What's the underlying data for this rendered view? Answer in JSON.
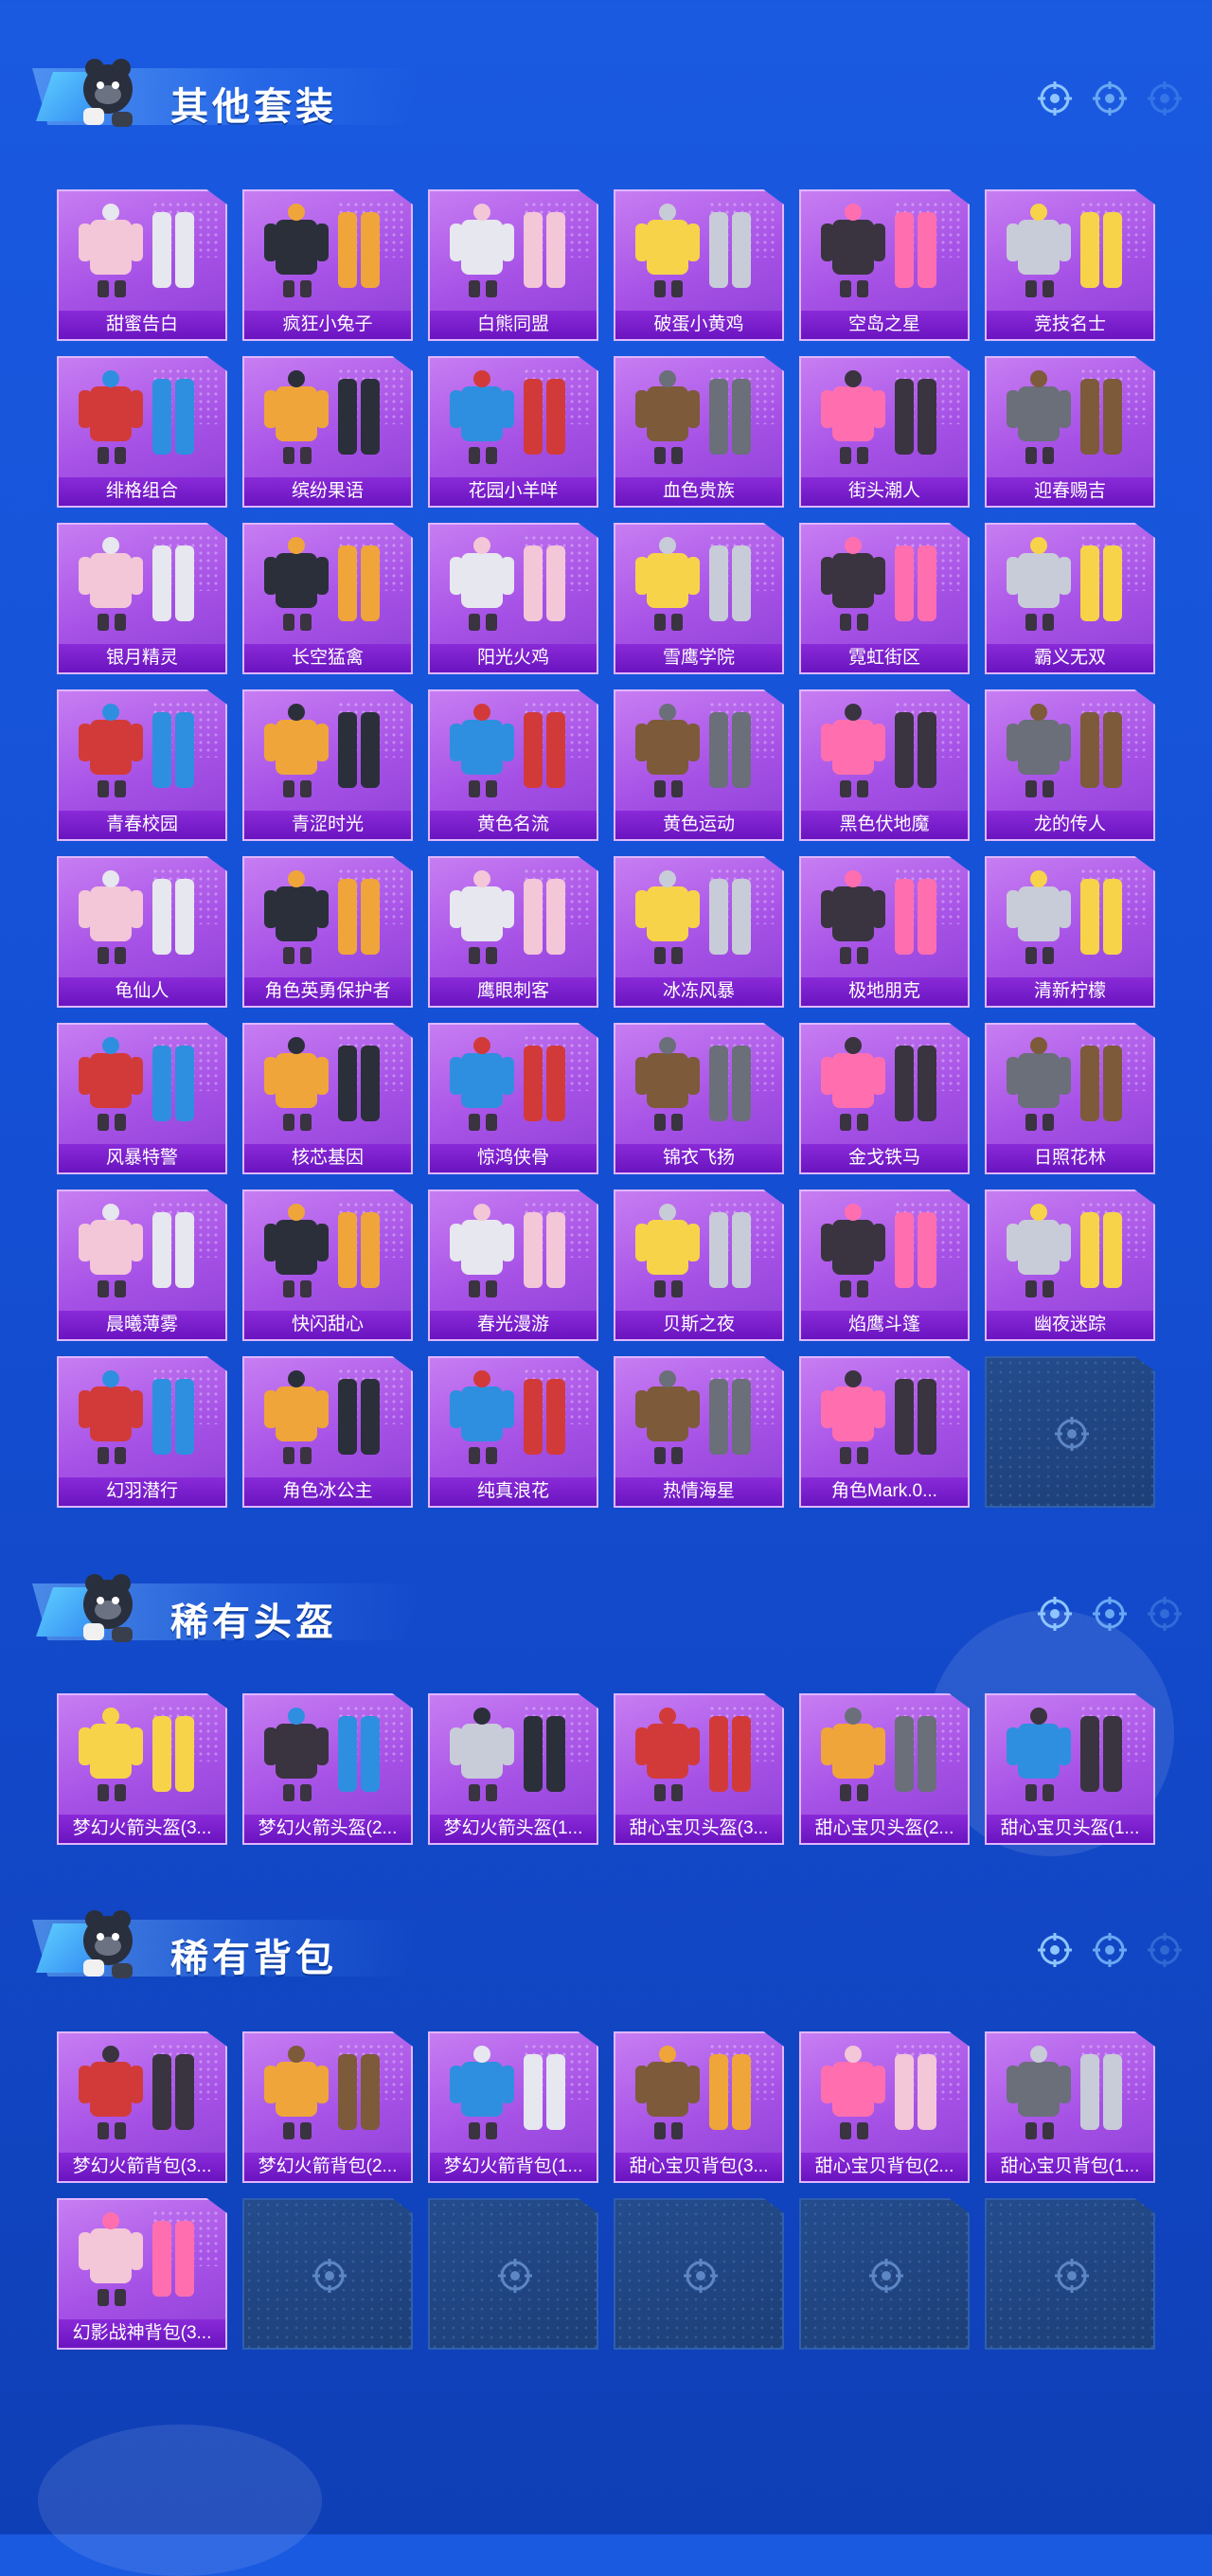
{
  "sections": [
    {
      "title": "其他套装",
      "items": [
        "甜蜜告白",
        "疯狂小兔子",
        "白熊同盟",
        "破蛋小黄鸡",
        "空岛之星",
        "竞技名士",
        "绯格组合",
        "缤纷果语",
        "花园小羊咩",
        "血色贵族",
        "街头潮人",
        "迎春赐吉",
        "银月精灵",
        "长空猛禽",
        "阳光火鸡",
        "雪鹰学院",
        "霓虹街区",
        "霸义无双",
        "青春校园",
        "青涩时光",
        "黄色名流",
        "黄色运动",
        "黑色伏地魔",
        "龙的传人",
        "龟仙人",
        "角色英勇保护者",
        "鹰眼刺客",
        "冰冻风暴",
        "极地朋克",
        "清新柠檬",
        "风暴特警",
        "核芯基因",
        "惊鸿侠骨",
        "锦衣飞扬",
        "金戈铁马",
        "日照花林",
        "晨曦薄雾",
        "快闪甜心",
        "春光漫游",
        "贝斯之夜",
        "焰鹰斗篷",
        "幽夜迷踪",
        "幻羽潜行",
        "角色冰公主",
        "纯真浪花",
        "热情海星",
        "角色Mark.0..."
      ],
      "empty_slots": 1
    },
    {
      "title": "稀有头盔",
      "items": [
        "梦幻火箭头盔(3...",
        "梦幻火箭头盔(2...",
        "梦幻火箭头盔(1...",
        "甜心宝贝头盔(3...",
        "甜心宝贝头盔(2...",
        "甜心宝贝头盔(1..."
      ],
      "empty_slots": 0
    },
    {
      "title": "稀有背包",
      "items": [
        "梦幻火箭背包(3...",
        "梦幻火箭背包(2...",
        "梦幻火箭背包(1...",
        "甜心宝贝背包(3...",
        "甜心宝贝背包(2...",
        "甜心宝贝背包(1...",
        "幻影战神背包(3..."
      ],
      "empty_slots": 5
    }
  ],
  "icons": {
    "header_right": [
      "crosshair-icon",
      "crosshair-icon",
      "crosshair-icon"
    ],
    "empty_slot": "crosshair-icon",
    "mascot": "mascot-icon"
  },
  "colors": {
    "card_purple": "#a651e6",
    "label_purple": "#7a1fce",
    "empty_slot": "#244c8c",
    "background": "#1552d8"
  }
}
